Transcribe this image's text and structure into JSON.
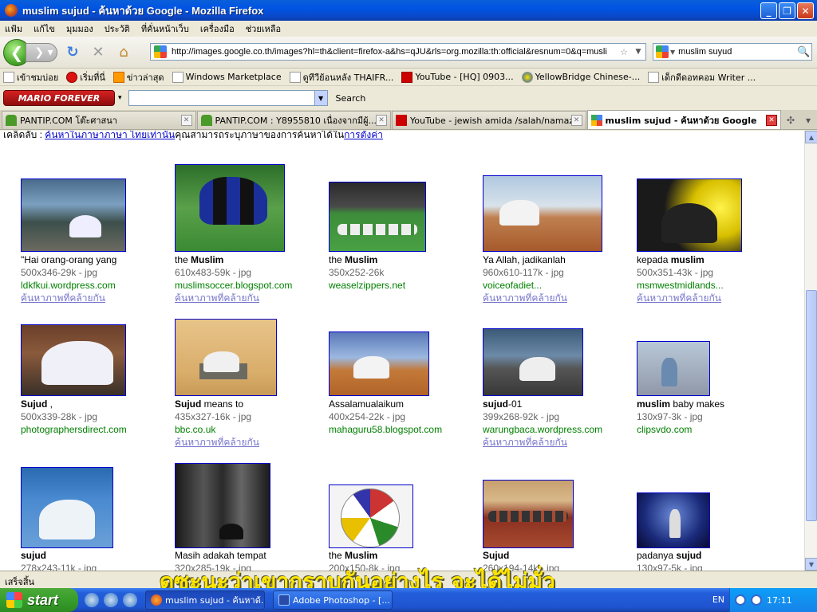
{
  "window": {
    "title": "muslim sujud - ค้นหาด้วย Google - Mozilla Firefox",
    "min_glyph": "_",
    "max_glyph": "❐",
    "close_glyph": "✕"
  },
  "menu": [
    "แฟ้ม",
    "แก้ไข",
    "มุมมอง",
    "ประวัติ",
    "ที่คั่นหน้าเว็บ",
    "เครื่องมือ",
    "ช่วยเหลือ"
  ],
  "nav": {
    "back_glyph": "❮",
    "forward_glyph": "❯ ▾",
    "reload_glyph": "↻",
    "stop_glyph": "✕",
    "home_glyph": "⌂",
    "url": "http://images.google.co.th/images?hl=th&client=firefox-a&hs=qJU&rls=org.mozilla:th:official&resnum=0&q=musli",
    "star_glyph": "☆",
    "drop_glyph": "▼",
    "search_value": "muslim suyud",
    "search_drop_glyph": "▼",
    "search_icon_glyph": "🔍"
  },
  "bookmarks": [
    {
      "label": "เข้าชมบ่อย",
      "icon": "page"
    },
    {
      "label": "เริ่มที่นี่",
      "icon": "red"
    },
    {
      "label": "ข่าวล่าสุด",
      "icon": "rss"
    },
    {
      "label": "Windows Marketplace",
      "icon": "page"
    },
    {
      "label": "ดูทีวีย้อนหลัง  THAIFR...",
      "icon": "page"
    },
    {
      "label": "YouTube - [HQ] 0903...",
      "icon": "yt"
    },
    {
      "label": "YellowBridge Chinese-...",
      "icon": "yb"
    },
    {
      "label": "เด็กดีดอทคอม  Writer ...",
      "icon": "page"
    }
  ],
  "toolbar": {
    "logo_text": "MARIO FOREVER",
    "drop_glyph": "▾",
    "combo_glyph": "▼",
    "search_label": "Search"
  },
  "tabs": [
    {
      "label": "PANTIP.COM โต๊ะศาสนา",
      "icon": "cact",
      "active": false
    },
    {
      "label": "PANTIP.COM : Y8955810 เนื่องจากมีผู้...",
      "icon": "cact",
      "active": false
    },
    {
      "label": "YouTube - jewish amida /salah/namaz...",
      "icon": "yt",
      "active": false
    },
    {
      "label": "muslim sujud - ค้นหาด้วย Google",
      "icon": "g",
      "active": true
    }
  ],
  "tab_controls": {
    "new_tab_glyph": "✣",
    "list_glyph": "▾",
    "close_glyph": "✕"
  },
  "topline": {
    "prefix": "เคล็ดลับ : ",
    "link": "ค้นหาในภาษาภาษา ไทยเท่านั้น",
    "middle": "คุณสามารถระบุภาษาของการค้นหาได้ใน",
    "link2": "การตั้งค่า"
  },
  "results": [
    {
      "title_pre": "\"Hai orang-orang yang",
      "title_bold": "",
      "title_post": "",
      "dims": "500x346-29k - jpg",
      "site": "ldkfkui.wordpress.com",
      "similar": "ค้นหาภาพที่คล้ายกัน"
    },
    {
      "title_pre": "the ",
      "title_bold": "Muslim",
      "title_post": "",
      "dims": "610x483-59k - jpg",
      "site": "muslimsoccer.blogspot.com",
      "similar": "ค้นหาภาพที่คล้ายกัน"
    },
    {
      "title_pre": "the ",
      "title_bold": "Muslim",
      "title_post": "",
      "dims": "350x252-26k",
      "site": "weaselzippers.net",
      "similar": ""
    },
    {
      "title_pre": "Ya Allah, jadikanlah",
      "title_bold": "",
      "title_post": "",
      "dims": "960x610-117k - jpg",
      "site": "voiceofadiet...",
      "similar": "ค้นหาภาพที่คล้ายกัน"
    },
    {
      "title_pre": "kepada ",
      "title_bold": "muslim",
      "title_post": "",
      "dims": "500x351-43k - jpg",
      "site": "msmwestmidlands...",
      "similar": "ค้นหาภาพที่คล้ายกัน"
    },
    {
      "title_pre": "",
      "title_bold": "Sujud",
      "title_post": " ,",
      "dims": "500x339-28k - jpg",
      "site": "photographersdirect.com",
      "similar": ""
    },
    {
      "title_pre": "",
      "title_bold": "Sujud",
      "title_post": " means to",
      "dims": "435x327-16k - jpg",
      "site": "bbc.co.uk",
      "similar": "ค้นหาภาพที่คล้ายกัน"
    },
    {
      "title_pre": "Assalamualaikum",
      "title_bold": "",
      "title_post": "",
      "dims": "400x254-22k - jpg",
      "site": "mahaguru58.blogspot.com",
      "similar": ""
    },
    {
      "title_pre": "",
      "title_bold": "sujud",
      "title_post": "-01",
      "dims": "399x268-92k - jpg",
      "site": "warungbaca.wordpress.com",
      "similar": "ค้นหาภาพที่คล้ายกัน"
    },
    {
      "title_pre": "",
      "title_bold": "muslim",
      "title_post": " baby makes",
      "dims": "130x97-3k - jpg",
      "site": "clipsvdo.com",
      "similar": ""
    },
    {
      "title_pre": "",
      "title_bold": "sujud",
      "title_post": "",
      "dims": "278x243-11k - jpg",
      "site": "",
      "similar": ""
    },
    {
      "title_pre": "Masih adakah tempat",
      "title_bold": "",
      "title_post": "",
      "dims": "320x285-19k - jpg",
      "site": "",
      "similar": ""
    },
    {
      "title_pre": "the ",
      "title_bold": "Muslim",
      "title_post": "",
      "dims": "200x150-8k - jpg",
      "site": "",
      "similar": ""
    },
    {
      "title_pre": "",
      "title_bold": "Sujud",
      "title_post": "",
      "dims": "260x194-14k - jpg",
      "site": "",
      "similar": ""
    },
    {
      "title_pre": "padanya ",
      "title_bold": "sujud",
      "title_post": "",
      "dims": "130x97-5k - jpg",
      "site": "",
      "similar": ""
    }
  ],
  "status": "เสร็จสิ้น",
  "subtitle": "ดูซะนะว่าเขากราบกันอย่างไร  จะได้ไม่มั่ว",
  "taskbar": {
    "start": "start",
    "tasks": [
      {
        "label": "muslim sujud - ค้นหาด้...",
        "icon": "ff",
        "active": true
      },
      {
        "label": "Adobe Photoshop - [...",
        "icon": "ps",
        "active": false
      }
    ],
    "lang": "EN",
    "clock": "17:11"
  }
}
